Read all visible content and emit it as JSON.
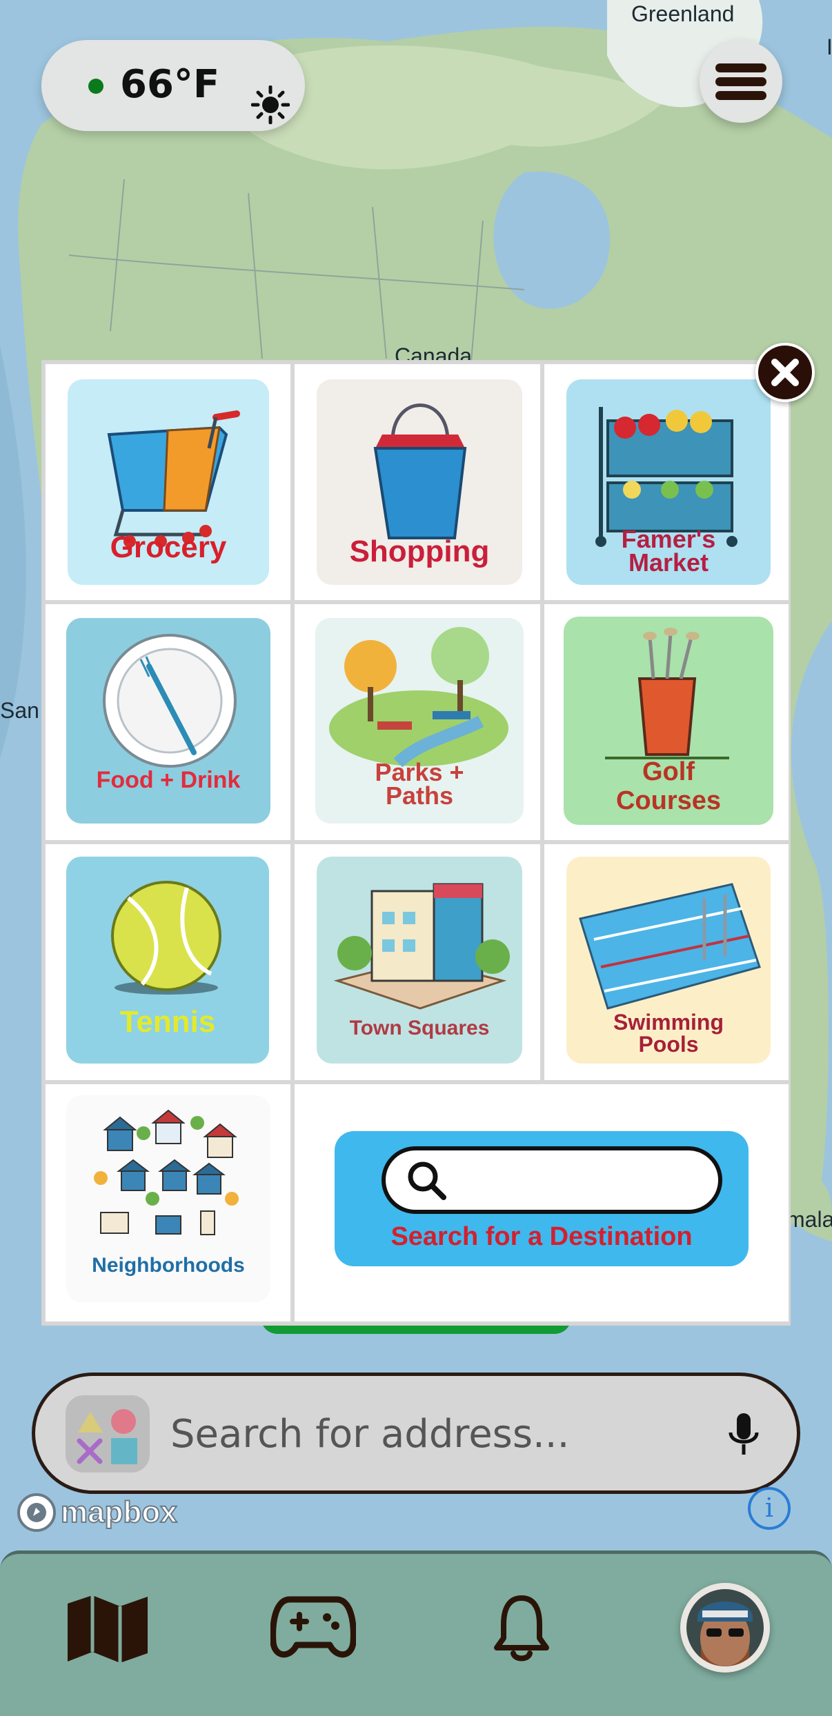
{
  "map": {
    "labels": {
      "greenland": "Greenland",
      "canada": "Canada",
      "san": "San F",
      "mala": "mala",
      "edge": "I"
    }
  },
  "weather": {
    "temperature": "66°F",
    "status_color": "#0a7a1b",
    "icon": "sun-icon"
  },
  "menu": {
    "icon": "hamburger-menu-icon"
  },
  "categories": [
    {
      "id": "grocery",
      "label": "Grocery",
      "bg": "#c5ecf7",
      "color": "#d8202b"
    },
    {
      "id": "shopping",
      "label": "Shopping",
      "bg": "#f1ede8",
      "color": "#c91f3a"
    },
    {
      "id": "farmers-market",
      "label_line1": "Famer's",
      "label_line2": "Market",
      "bg": "#aee0f1",
      "color": "#b51f43"
    },
    {
      "id": "food-drink",
      "label": "Food + Drink",
      "bg": "#8dcde0",
      "color": "#e22c3c"
    },
    {
      "id": "parks-paths",
      "label_line1": "Parks +",
      "label_line2": "Paths",
      "bg": "#e6f3f1",
      "color": "#c8413c"
    },
    {
      "id": "golf-courses",
      "label_line1": "Golf",
      "label_line2": "Courses",
      "bg": "#a9e2ab",
      "color": "#b83424"
    },
    {
      "id": "tennis",
      "label": "Tennis",
      "bg": "#8fd2e5",
      "color": "#e4ea2a"
    },
    {
      "id": "town-squares",
      "label": "Town Squares",
      "bg": "#bfe3e3",
      "color": "#b03a43"
    },
    {
      "id": "swimming-pools",
      "label_line1": "Swimming",
      "label_line2": "Pools",
      "bg": "#fcefc7",
      "color": "#a6203a"
    },
    {
      "id": "neighborhoods",
      "label": "Neighborhoods",
      "bg": "#fafafa",
      "color": "#1f6fa6"
    }
  ],
  "destination_search": {
    "label": "Search for a Destination",
    "bg": "#3fb8ee",
    "color": "#d3202e"
  },
  "search": {
    "placeholder": "Search for address...",
    "mic_icon": "microphone-icon",
    "categories_icon": "shapes-icon"
  },
  "attribution": {
    "mapbox": "mapbox",
    "info": "i"
  },
  "nav": {
    "items": [
      {
        "id": "map",
        "icon": "map-icon"
      },
      {
        "id": "games",
        "icon": "gamepad-icon"
      },
      {
        "id": "notifications",
        "icon": "bell-icon"
      },
      {
        "id": "profile",
        "icon": "avatar"
      }
    ]
  }
}
